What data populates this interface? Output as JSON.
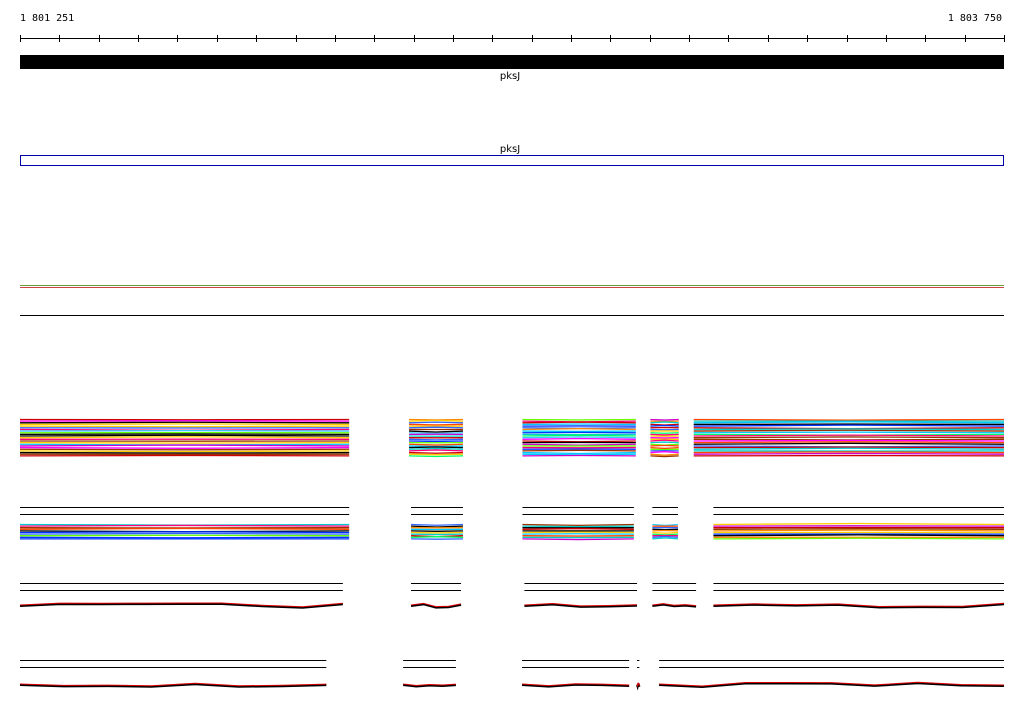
{
  "ruler": {
    "start_label": "1 801 251",
    "end_label": "1 803 750",
    "start": 1801251,
    "end": 1803750,
    "tick_count": 26
  },
  "gene_track": {
    "label": "pksJ",
    "color": "#000000"
  },
  "transcript_track": {
    "label": "pksJ",
    "outline_color": "#0000aa"
  },
  "colors": {
    "ruler": "#000000",
    "green_line": "#6a9a3a",
    "red_line": "#cc4444",
    "alignment_palette": [
      "#00c8ff",
      "#ff00ff",
      "#00ff66",
      "#ff4400",
      "#0033ff",
      "#ffcc00",
      "#cc00cc",
      "#33ccff",
      "#ff0077",
      "#66ff00",
      "#993300",
      "#ff8800",
      "#000000",
      "#3366ff",
      "#cc0000",
      "#00cccc"
    ]
  },
  "alignment_blocks": [
    {
      "row": 1,
      "segments": [
        [
          1801251,
          1802087
        ],
        [
          1802239,
          1802376
        ],
        [
          1802527,
          1802815
        ],
        [
          1802852,
          1802924
        ],
        [
          1802962,
          1803750
        ]
      ]
    },
    {
      "row": 2,
      "segments": [
        [
          1801251,
          1802087
        ],
        [
          1802244,
          1802376
        ],
        [
          1802527,
          1802810
        ],
        [
          1802857,
          1802922
        ],
        [
          1803012,
          1803750
        ]
      ]
    },
    {
      "row": 3,
      "segments": [
        [
          1801251,
          1802071
        ],
        [
          1802244,
          1802371
        ],
        [
          1802532,
          1802818
        ],
        [
          1802857,
          1802968
        ],
        [
          1803012,
          1803750
        ]
      ]
    },
    {
      "row": 4,
      "segments": [
        [
          1801251,
          1802029
        ],
        [
          1802224,
          1802358
        ],
        [
          1802526,
          1802798
        ],
        [
          1802818,
          1802824
        ],
        [
          1802874,
          1803750
        ]
      ]
    }
  ]
}
